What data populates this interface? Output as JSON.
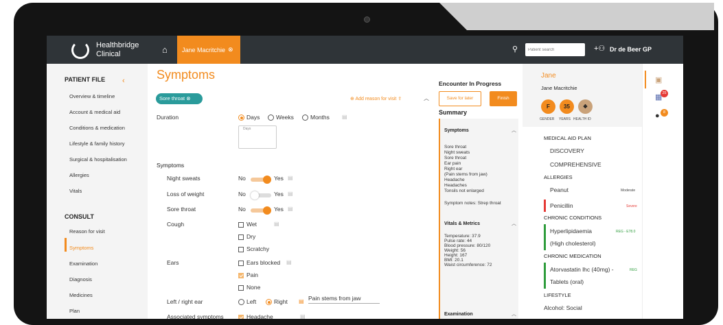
{
  "header": {
    "logo_line1": "Healthbridge",
    "logo_line2": "Clinical",
    "patient_tab": "Jane Macritchie",
    "search_placeholder": "Patient search",
    "doctor": "Dr de Beer GP"
  },
  "sidebar": {
    "patient_file": "PATIENT FILE",
    "patient_items": [
      "Overview & timeline",
      "Account & medical aid",
      "Conditions & medication",
      "Lifestyle & family history",
      "Surgical & hospitalisation",
      "Allergies",
      "Vitals"
    ],
    "consult": "CONSULT",
    "consult_items": [
      "Reason for visit",
      "Symptoms",
      "Examination",
      "Diagnosis",
      "Medicines",
      "Plan"
    ]
  },
  "main": {
    "title": "Symptoms",
    "chip": "Sore throat",
    "add_reason": "Add reason for visit",
    "duration_label": "Duration",
    "duration_options": [
      "Days",
      "Weeks",
      "Months"
    ],
    "days_placeholder": "Days",
    "symptoms_heading": "Symptoms",
    "rows": [
      {
        "label": "Night sweats",
        "no": "No",
        "yes": "Yes"
      },
      {
        "label": "Loss of weight",
        "no": "No",
        "yes": "Yes"
      },
      {
        "label": "Sore throat",
        "no": "No",
        "yes": "Yes"
      }
    ],
    "cough_label": "Cough",
    "cough_options": [
      "Wet",
      "Dry",
      "Scratchy"
    ],
    "ears_label": "Ears",
    "ears_options": [
      "Ears blocked",
      "Pain",
      "None"
    ],
    "lr_label": "Left / right ear",
    "lr_options": [
      "Left",
      "Right"
    ],
    "lr_note": "Pain stems from jaw",
    "assoc_label": "Associated symptoms",
    "assoc_option": "Headache"
  },
  "encounter": {
    "title": "Encounter In Progress",
    "save": "Save for later",
    "finish": "Finish",
    "summary": "Summary",
    "symptoms_h": "Symptoms",
    "symptoms_text": "Sore throat\nNight sweats\nSore throat\nEar pain\nRight ear\n(Pain stems from jaw)\nHeadache\nHeadaches\nTonsils not enlarged",
    "symptom_notes": "Symptom notes: Strep throat",
    "vitals_h": "Vitals & Metrics",
    "vitals_text": "Temperature: 37.9\nPulse rate: 44\nBlood pressure: 80/120\nWeight: 56\nHeight: 167\nBMI: 20.1\nWaist circumference: 72",
    "exam_h": "Examination"
  },
  "patient": {
    "first": "Jane",
    "full": "Jane Macritchie",
    "gender": "F",
    "years": "35",
    "gender_lbl": "GENDER",
    "years_lbl": "YEARS",
    "hid_lbl": "HEALTH ID",
    "medical_aid_h": "MEDICAL AID PLAN",
    "aid1": "DISCOVERY",
    "aid2": "COMPREHENSIVE",
    "allergies_h": "ALLERGIES",
    "allergy1": "Peanut",
    "allergy1_sev": "Moderate",
    "allergy2": "Penicillin",
    "allergy2_sev": "Severe",
    "chronic_h": "CHRONIC CONDITIONS",
    "cond1": "Hyperlipidaemia",
    "cond1_code": "REG - E78.0",
    "cond2": "(High cholesterol)",
    "med_h": "CHRONIC MEDICATION",
    "med1": "Atorvastatin lhc (40mg) -",
    "med1_code": "REG",
    "med2": "Tablets (oral)",
    "lifestyle_h": "LIFESTYLE",
    "life1": "Alcohol: Social"
  },
  "edge": {
    "badge1": "25",
    "badge2": "8"
  },
  "colors": {
    "accent": "#f28b1e",
    "teal": "#2a9b9b",
    "dark": "#2f3438"
  }
}
